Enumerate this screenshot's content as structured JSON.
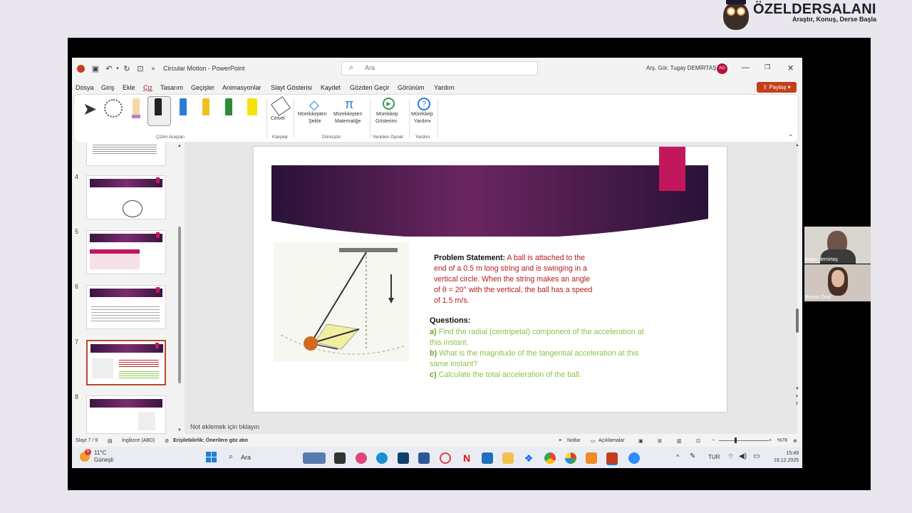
{
  "brand": {
    "title": "ÖZELDERSALANI",
    "tagline": "Araştır, Konuş, Derse Başla"
  },
  "window": {
    "doc_title": "Circular Motion  -  PowerPoint",
    "search_placeholder": "Ara",
    "user_name": "Arş. Gör. Tugay DEMİRTAŞ",
    "avatar_initials": "AG"
  },
  "menu": [
    "Dosya",
    "Giriş",
    "Ekle",
    "Çiz",
    "Tasarım",
    "Geçişler",
    "Animasyonlar",
    "Slayt Gösterisi",
    "Kaydet",
    "Gözden Geçir",
    "Görünüm",
    "Yardım"
  ],
  "share_label": "Paylaş",
  "ribbon": {
    "groups": {
      "drawing_tools": "Çizim Araçları",
      "stencils": "Kalıplar",
      "convert": "Dönüştür",
      "replay": "Yeniden Oynat",
      "help": "Yardım"
    },
    "buttons": {
      "ruler": "Cetvel",
      "ink_to_shape_1": "Mürekkepten",
      "ink_to_shape_2": "Şekle",
      "ink_to_math_1": "Mürekkepten",
      "ink_to_math_2": "Matematiğe",
      "ink_replay_1": "Mürekkep",
      "ink_replay_2": "Gösterimi",
      "ink_help_1": "Mürekkep",
      "ink_help_2": "Yardımı"
    }
  },
  "thumbnails": [
    {
      "num": "4"
    },
    {
      "num": "5"
    },
    {
      "num": "6"
    },
    {
      "num": "7",
      "selected": true
    },
    {
      "num": "8"
    }
  ],
  "slide": {
    "problem_label": "Problem Statement:",
    "problem_text": " A ball is attached to the end of a 0.5 m long string and is swinging in a vertical circle. When the string makes an angle of θ = 20° with the vertical, the ball has a speed of 1.5 m/s.",
    "questions_label": "Questions:",
    "q_a_label": "a)",
    "q_a": " Find the radial (centripetal) component of the acceleration at this instant.",
    "q_b_label": "b)",
    "q_b": " What is the magnitude of the tangential acceleration at this same instant?",
    "q_c_label": "c)",
    "q_c": " Calculate the total acceleration of the ball."
  },
  "notes_placeholder": "Not eklemek için tıklayın",
  "status": {
    "slide_count": "Slayt 7 / 9",
    "language": "İngilizce (ABD)",
    "accessibility": "Erişilebilirlik: Önerilere göz atın",
    "notes": "Notlar",
    "comments": "Açıklamalar",
    "zoom": "%78"
  },
  "taskbar": {
    "weather_temp": "11°C",
    "weather_desc": "Güneşli",
    "weather_badge": "5",
    "search": "Ara",
    "lang": "TUR",
    "time": "15:49",
    "date": "19.12.2025"
  },
  "participants": [
    {
      "name": "tugay demirtaş"
    },
    {
      "name": "Beyza Önal"
    }
  ],
  "colors": {
    "accent": "#c43e1c",
    "slide_band": "#5b1f55",
    "problem_red": "#b71c1c",
    "question_green": "#8bc34a"
  }
}
